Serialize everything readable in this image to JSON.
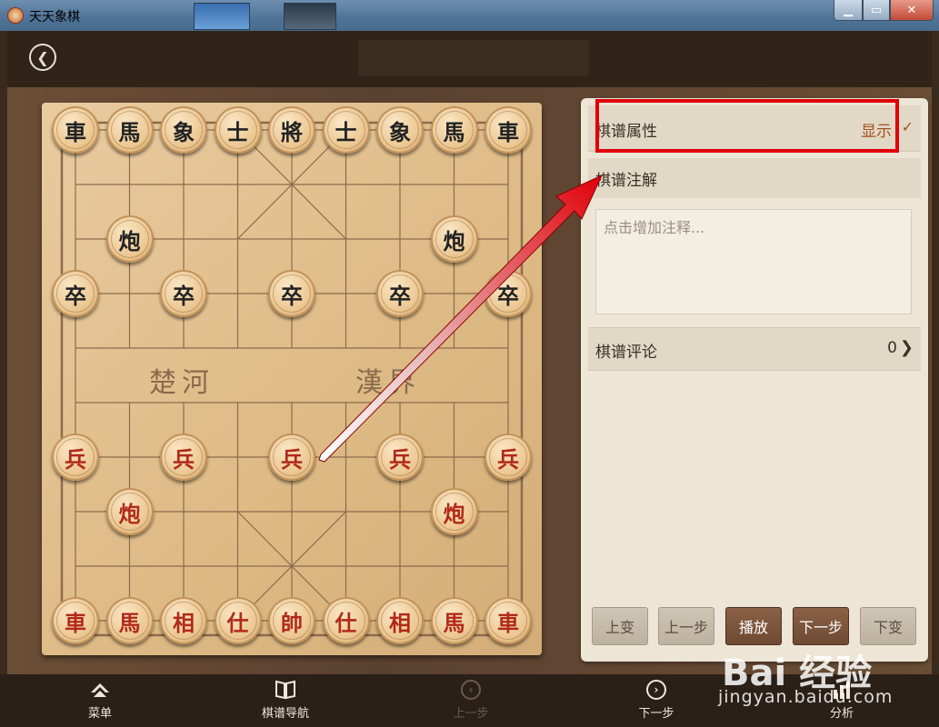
{
  "window": {
    "app_title": "天天象棋",
    "colors": {
      "titlebar": "#4f7396",
      "close": "#c24a36"
    }
  },
  "header": {
    "back_icon": "back-chevron-icon"
  },
  "board": {
    "river_left": "楚河",
    "river_right": "漢界",
    "black_pieces": [
      {
        "label": "車",
        "file": 0,
        "rank": 0
      },
      {
        "label": "馬",
        "file": 1,
        "rank": 0
      },
      {
        "label": "象",
        "file": 2,
        "rank": 0
      },
      {
        "label": "士",
        "file": 3,
        "rank": 0
      },
      {
        "label": "將",
        "file": 4,
        "rank": 0
      },
      {
        "label": "士",
        "file": 5,
        "rank": 0
      },
      {
        "label": "象",
        "file": 6,
        "rank": 0
      },
      {
        "label": "馬",
        "file": 7,
        "rank": 0
      },
      {
        "label": "車",
        "file": 8,
        "rank": 0
      },
      {
        "label": "炮",
        "file": 1,
        "rank": 2
      },
      {
        "label": "炮",
        "file": 7,
        "rank": 2
      },
      {
        "label": "卒",
        "file": 0,
        "rank": 3
      },
      {
        "label": "卒",
        "file": 2,
        "rank": 3
      },
      {
        "label": "卒",
        "file": 4,
        "rank": 3
      },
      {
        "label": "卒",
        "file": 6,
        "rank": 3
      },
      {
        "label": "卒",
        "file": 8,
        "rank": 3
      }
    ],
    "red_pieces": [
      {
        "label": "兵",
        "file": 0,
        "rank": 6
      },
      {
        "label": "兵",
        "file": 2,
        "rank": 6
      },
      {
        "label": "兵",
        "file": 4,
        "rank": 6
      },
      {
        "label": "兵",
        "file": 6,
        "rank": 6
      },
      {
        "label": "兵",
        "file": 8,
        "rank": 6
      },
      {
        "label": "炮",
        "file": 1,
        "rank": 7
      },
      {
        "label": "炮",
        "file": 7,
        "rank": 7
      },
      {
        "label": "車",
        "file": 0,
        "rank": 9
      },
      {
        "label": "馬",
        "file": 1,
        "rank": 9
      },
      {
        "label": "相",
        "file": 2,
        "rank": 9
      },
      {
        "label": "仕",
        "file": 3,
        "rank": 9
      },
      {
        "label": "帥",
        "file": 4,
        "rank": 9
      },
      {
        "label": "仕",
        "file": 5,
        "rank": 9
      },
      {
        "label": "相",
        "file": 6,
        "rank": 9
      },
      {
        "label": "馬",
        "file": 7,
        "rank": 9
      },
      {
        "label": "車",
        "file": 8,
        "rank": 9
      }
    ]
  },
  "panel": {
    "properties_label": "棋谱属性",
    "properties_toggle": "显示",
    "annotation_label": "棋谱注解",
    "annotation_placeholder": "点击增加注释...",
    "comments_label": "棋谱评论",
    "comments_count": "0",
    "buttons": {
      "prev_variation": "上变",
      "prev_step": "上一步",
      "play": "播放",
      "next_step": "下一步",
      "next_variation": "下变"
    }
  },
  "bottom_nav": {
    "menu": "菜单",
    "navigation": "棋谱导航",
    "prev": "上一步",
    "next": "下一步",
    "analysis": "分析"
  },
  "watermark": {
    "logo": "Bai 经验",
    "url": "jingyan.baidu.com"
  }
}
